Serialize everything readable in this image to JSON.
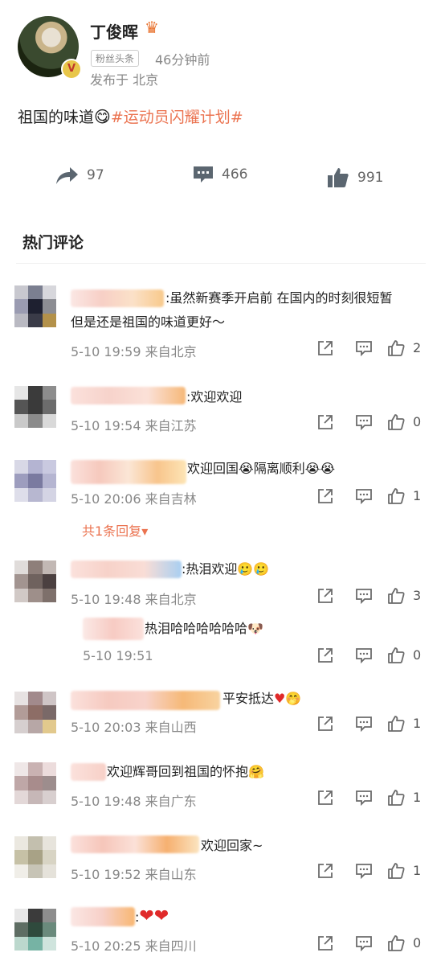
{
  "post": {
    "username": "丁俊晖",
    "fans_tag": "粉丝头条",
    "time": "46分钟前",
    "location": "发布于 北京",
    "text_main": "祖国的味道",
    "text_emoji": "😋",
    "text_tag": "#运动员闪耀计划#",
    "reposts": "97",
    "comments": "466",
    "likes": "991"
  },
  "hot_title": "热门评论",
  "comments": [
    {
      "text": ":虽然新赛季开启前 在国内的时刻很短暂",
      "text2": "但是还是祖国的味道更好～",
      "meta": "5-10 19:59 来自北京",
      "likes": "2"
    },
    {
      "text": ":欢迎欢迎",
      "meta": "5-10 19:54 来自江苏",
      "likes": "0"
    },
    {
      "text": "欢迎回国",
      "text_b": "隔离顺利",
      "meta": "5-10 20:06 来自吉林",
      "likes": "1",
      "replies": "共1条回复"
    },
    {
      "text": ":热泪欢迎",
      "meta": "5-10 19:48 来自北京",
      "likes": "3"
    },
    {
      "text": "热泪哈哈哈哈哈哈",
      "meta": "5-10 19:51",
      "likes": "0"
    },
    {
      "text": "平安抵达",
      "meta": "5-10 20:03 来自山西",
      "likes": "1"
    },
    {
      "text": "欢迎辉哥回到祖国的怀抱",
      "meta": "5-10 19:48 来自广东",
      "likes": "1"
    },
    {
      "text": "欢迎回家~",
      "meta": "5-10 19:52 来自山东",
      "likes": "1"
    },
    {
      "text": ":",
      "meta": "5-10 20:25 来自四川",
      "likes": "0"
    }
  ],
  "colors": {
    "accent": "#eb7350",
    "icon": "#5b6670"
  }
}
